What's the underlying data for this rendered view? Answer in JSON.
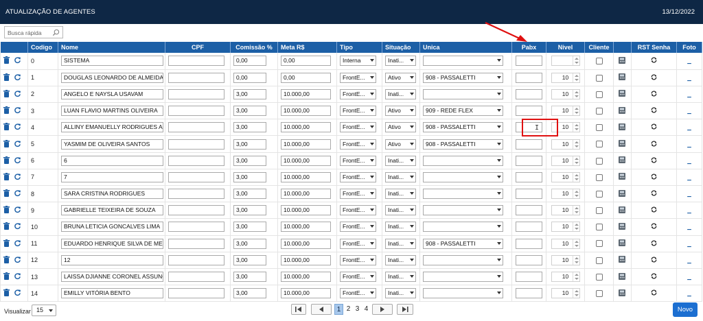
{
  "header": {
    "title": "ATUALIZAÇÃO DE AGENTES",
    "date": "13/12/2022"
  },
  "search": {
    "placeholder": "Busca rápida",
    "icon": "search-icon"
  },
  "columns": [
    "Codigo",
    "Nome",
    "CPF",
    "Comissão %",
    "Meta R$",
    "Tipo",
    "Situação",
    "Unica",
    "Pabx",
    "Nivel",
    "Cliente",
    "RST Senha",
    "Foto"
  ],
  "row_icons": {
    "delete": "trash-icon",
    "refresh": "refresh-icon",
    "device": "phone-device-icon",
    "reset": "reset-password-icon"
  },
  "rows": [
    {
      "codigo": "0",
      "nome": "SISTEMA",
      "cpf": "",
      "comissao": "0,00",
      "meta": "0,00",
      "tipo": "Interna",
      "situacao": "Inati...",
      "unica": "",
      "pabx": "",
      "nivel": "",
      "foto": "_"
    },
    {
      "codigo": "1",
      "nome": "DOUGLAS LEONARDO DE ALMEIDA DI",
      "cpf": "",
      "comissao": "0,00",
      "meta": "0,00",
      "tipo": "FrontE...",
      "situacao": "Ativo",
      "unica": "908 - PASSALETTI",
      "pabx": "",
      "nivel": "10",
      "foto": "_"
    },
    {
      "codigo": "2",
      "nome": "ANGELO E NAYSLA USAVAM",
      "cpf": "",
      "comissao": "3,00",
      "meta": "10.000,00",
      "tipo": "FrontE...",
      "situacao": "Inati...",
      "unica": "",
      "pabx": "",
      "nivel": "10",
      "foto": "_"
    },
    {
      "codigo": "3",
      "nome": "LUAN FLAVIO MARTINS OLIVEIRA",
      "cpf": "",
      "comissao": "3,00",
      "meta": "10.000,00",
      "tipo": "FrontE...",
      "situacao": "Ativo",
      "unica": "909 - REDE FLEX",
      "pabx": "",
      "nivel": "10",
      "foto": "_"
    },
    {
      "codigo": "4",
      "nome": "ALLINY EMANUELLY RODRIGUES AGU",
      "cpf": "",
      "comissao": "3,00",
      "meta": "10.000,00",
      "tipo": "FrontE...",
      "situacao": "Ativo",
      "unica": "908 - PASSALETTI",
      "pabx": "",
      "nivel": "10",
      "foto": "_"
    },
    {
      "codigo": "5",
      "nome": "YASMIM DE OLIVEIRA SANTOS",
      "cpf": "",
      "comissao": "3,00",
      "meta": "10.000,00",
      "tipo": "FrontE...",
      "situacao": "Ativo",
      "unica": "908 - PASSALETTI",
      "pabx": "",
      "nivel": "10",
      "foto": "_"
    },
    {
      "codigo": "6",
      "nome": "6",
      "cpf": "",
      "comissao": "3,00",
      "meta": "10.000,00",
      "tipo": "FrontE...",
      "situacao": "Inati...",
      "unica": "",
      "pabx": "",
      "nivel": "10",
      "foto": "_"
    },
    {
      "codigo": "7",
      "nome": "7",
      "cpf": "",
      "comissao": "3,00",
      "meta": "10.000,00",
      "tipo": "FrontE...",
      "situacao": "Inati...",
      "unica": "",
      "pabx": "",
      "nivel": "10",
      "foto": "_"
    },
    {
      "codigo": "8",
      "nome": "SARA CRISTINA RODRIGUES",
      "cpf": "",
      "comissao": "3,00",
      "meta": "10.000,00",
      "tipo": "FrontE...",
      "situacao": "Inati...",
      "unica": "",
      "pabx": "",
      "nivel": "10",
      "foto": "_"
    },
    {
      "codigo": "9",
      "nome": "GABRIELLE TEIXEIRA DE SOUZA",
      "cpf": "",
      "comissao": "3,00",
      "meta": "10.000,00",
      "tipo": "FrontE...",
      "situacao": "Inati...",
      "unica": "",
      "pabx": "",
      "nivel": "10",
      "foto": "_"
    },
    {
      "codigo": "10",
      "nome": "BRUNA LETICIA GONCALVES LIMA",
      "cpf": "",
      "comissao": "3,00",
      "meta": "10.000,00",
      "tipo": "FrontE...",
      "situacao": "Inati...",
      "unica": "",
      "pabx": "",
      "nivel": "10",
      "foto": "_"
    },
    {
      "codigo": "11",
      "nome": "EDUARDO HENRIQUE SILVA DE MELO",
      "cpf": "",
      "comissao": "3,00",
      "meta": "10.000,00",
      "tipo": "FrontE...",
      "situacao": "Inati...",
      "unica": "908 - PASSALETTI",
      "pabx": "",
      "nivel": "10",
      "foto": "_"
    },
    {
      "codigo": "12",
      "nome": "12",
      "cpf": "",
      "comissao": "3,00",
      "meta": "10.000,00",
      "tipo": "FrontE...",
      "situacao": "Inati...",
      "unica": "",
      "pabx": "",
      "nivel": "10",
      "foto": "_"
    },
    {
      "codigo": "13",
      "nome": "LAISSA DJIANNE CORONEL ASSUNCA",
      "cpf": "",
      "comissao": "3,00",
      "meta": "10.000,00",
      "tipo": "FrontE...",
      "situacao": "Inati...",
      "unica": "",
      "pabx": "",
      "nivel": "10",
      "foto": "_"
    },
    {
      "codigo": "14",
      "nome": "EMILLY VITÓRIA BENTO",
      "cpf": "",
      "comissao": "3,00",
      "meta": "10.000,00",
      "tipo": "FrontE...",
      "situacao": "Inati...",
      "unica": "",
      "pabx": "",
      "nivel": "10",
      "foto": "_"
    }
  ],
  "footer": {
    "visualizar_label": "Visualizar",
    "page_size": "15",
    "pages": [
      "1",
      "2",
      "3",
      "4"
    ],
    "current_page": "1",
    "novo_label": "Novo"
  },
  "colors": {
    "header_bg": "#0e2745",
    "table_header_bg": "#1c5fa6",
    "icon_blue": "#1c5fa6",
    "highlight_red": "#e01010",
    "button_blue": "#1c6fd1"
  }
}
